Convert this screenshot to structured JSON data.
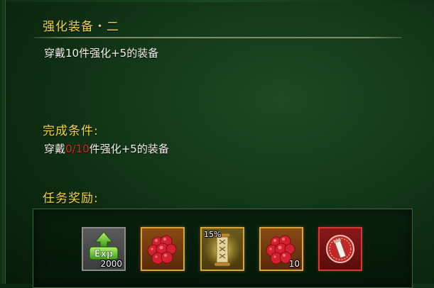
{
  "quest": {
    "title": "强化装备・二",
    "description": "穿戴10件强化+5的装备"
  },
  "condition": {
    "label": "完成条件:",
    "prefix": "穿戴",
    "current": "0",
    "separator": "/",
    "target": "10",
    "suffix": "件强化+5的装备"
  },
  "rewards": {
    "label": "任务奖励:",
    "items": [
      {
        "icon": "exp-icon",
        "count": "2000",
        "frame": "gray"
      },
      {
        "icon": "red-gem-cluster-icon",
        "count": "",
        "frame": "gold"
      },
      {
        "icon": "golden-scroll-icon",
        "percent": "15%",
        "frame": "gold"
      },
      {
        "icon": "red-gem-cluster-icon",
        "count": "10",
        "frame": "gold"
      },
      {
        "icon": "enhance-seal-icon",
        "count": "",
        "frame": "red"
      }
    ]
  },
  "colors": {
    "heading": "#f2d640",
    "progress_red": "#e0241c",
    "background": "#143a1a"
  }
}
